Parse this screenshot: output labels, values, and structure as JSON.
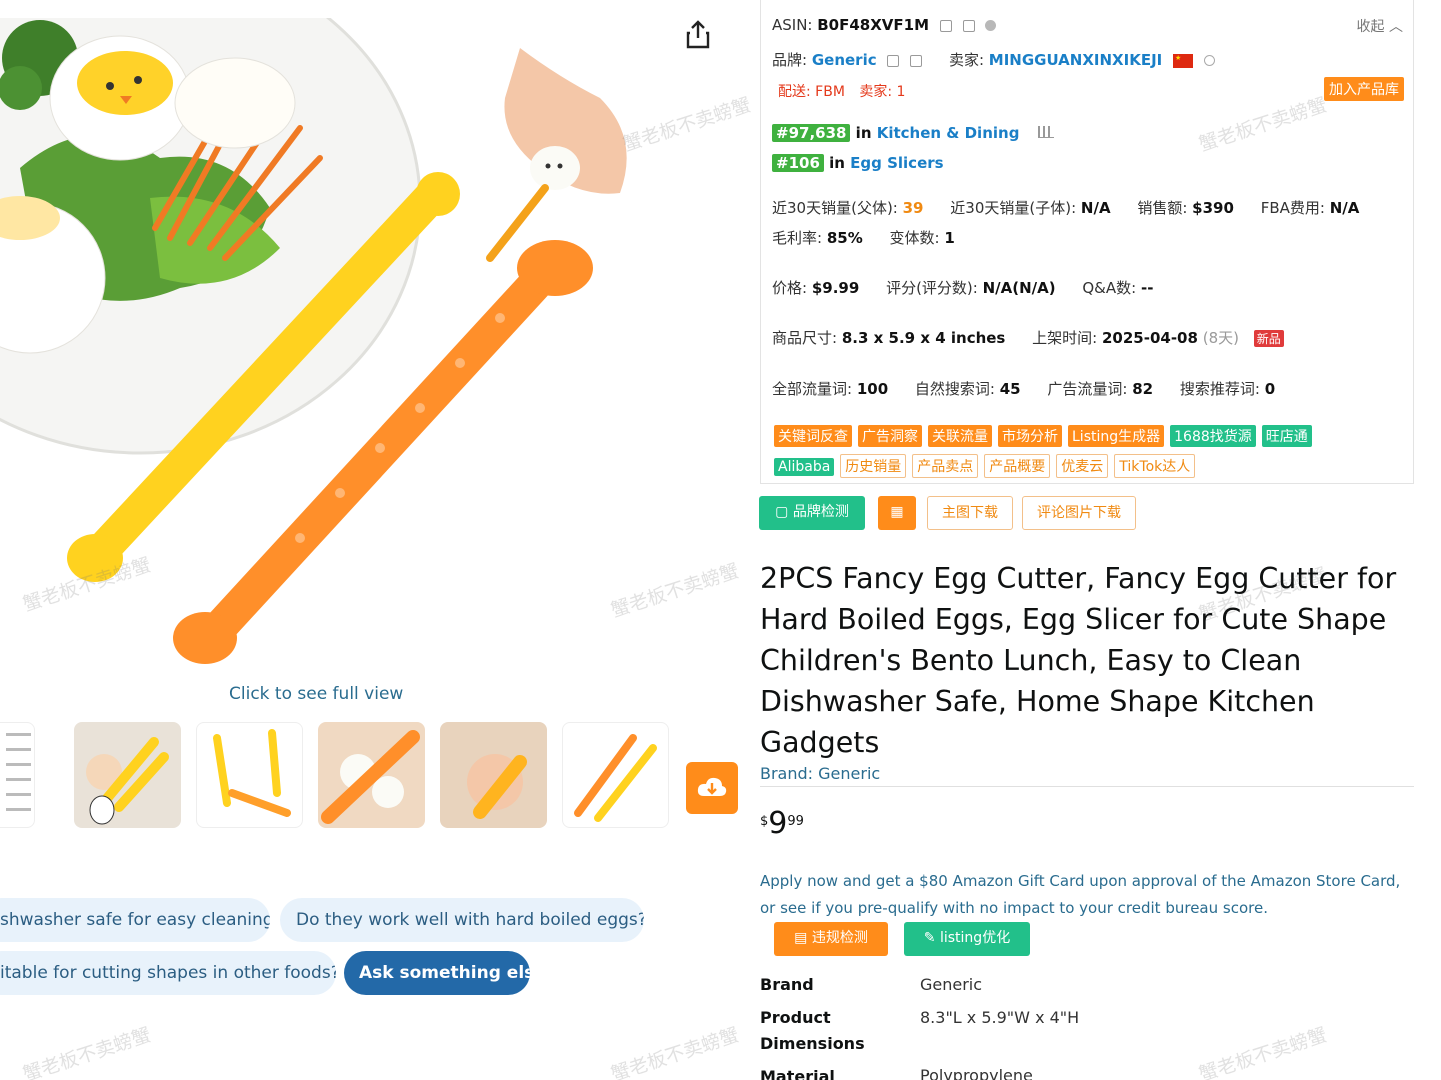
{
  "gallery": {
    "click_full_view": "Click to see full view",
    "thumbnail_count": 6
  },
  "chips": [
    {
      "label": "shwasher safe for easy cleaning?"
    },
    {
      "label": "Do they work well with hard boiled eggs?"
    },
    {
      "label": "itable for cutting shapes in other foods?"
    },
    {
      "label": "Ask something else"
    }
  ],
  "watermark": "蟹老板不卖螃蟹",
  "panel": {
    "collapse": "收起 ︿",
    "asin_label": "ASIN: ",
    "asin": "B0F48XVF1M",
    "brand_label": "品牌: ",
    "brand": "Generic",
    "seller_label": "卖家: ",
    "seller": "MINGGUANXINXIKEJI",
    "shipping": "配送: FBM",
    "sellers_count": "卖家: 1",
    "add_to_library": "加入产品库",
    "rank1_num": "#97,638",
    "rank1_in": " in ",
    "rank1_cat": "Kitchen & Dining",
    "rank2_num": "#106",
    "rank2_in": " in ",
    "rank2_cat": "Egg Slicers",
    "sales_parent_label": "近30天销量(父体): ",
    "sales_parent": "39",
    "sales_child_label": "近30天销量(子体): ",
    "sales_child": "N/A",
    "revenue_label": "销售额: ",
    "revenue": "$390",
    "fba_label": "FBA费用: ",
    "fba": "N/A",
    "margin_label": "毛利率: ",
    "margin": "85%",
    "variants_label": "变体数: ",
    "variants": "1",
    "price_label": "价格: ",
    "price": "$9.99",
    "rating_label": "评分(评分数): ",
    "rating": "N/A(N/A)",
    "qa_label": "Q&A数: ",
    "qa": "--",
    "size_label": "商品尺寸: ",
    "size": "8.3 x 5.9 x 4 inches",
    "listed_label": "上架时间: ",
    "listed": "2025-04-08",
    "listed_days": "(8天)",
    "new_badge": "新品",
    "traffic_all_label": "全部流量词: ",
    "traffic_all": "100",
    "traffic_organic_label": "自然搜索词: ",
    "traffic_organic": "45",
    "traffic_ad_label": "广告流量词: ",
    "traffic_ad": "82",
    "traffic_rec_label": "搜索推荐词: ",
    "traffic_rec": "0",
    "tools_row1": [
      {
        "label": "关键词反查",
        "style": "o"
      },
      {
        "label": "广告洞察",
        "style": "o"
      },
      {
        "label": "关联流量",
        "style": "o"
      },
      {
        "label": "市场分析",
        "style": "o"
      },
      {
        "label": "Listing生成器",
        "style": "o"
      },
      {
        "label": "1688找货源",
        "style": "g"
      },
      {
        "label": "旺店通",
        "style": "g"
      }
    ],
    "tools_row2": [
      {
        "label": "Alibaba",
        "style": "g"
      },
      {
        "label": "历史销量",
        "style": "line"
      },
      {
        "label": "产品卖点",
        "style": "line"
      },
      {
        "label": "产品概要",
        "style": "line"
      },
      {
        "label": "优麦云",
        "style": "line"
      },
      {
        "label": "TikTok达人",
        "style": "line"
      }
    ]
  },
  "actions": {
    "brand_check": "品牌检测",
    "main_image_download": "主图下载",
    "review_image_download": "评论图片下载"
  },
  "product": {
    "title": "2PCS Fancy Egg Cutter, Fancy Egg Cutter for Hard Boiled Eggs, Egg Slicer for Cute Shape Children's Bento Lunch, Easy to Clean Dishwasher Safe, Home Shape Kitchen Gadgets",
    "brand_link": "Brand: Generic",
    "price_symbol": "$",
    "price_whole": "9",
    "price_fraction": "99",
    "promo": "Apply now and get a $80 Amazon Gift Card upon approval of the Amazon Store Card, or see if you pre-qualify with no impact to your credit bureau score.",
    "violation_check": "违规检测",
    "listing_optimize": "listing优化",
    "specs": [
      {
        "label": "Brand",
        "value": "Generic"
      },
      {
        "label": "Product Dimensions",
        "value": "8.3\"L x 5.9\"W x 4\"H"
      },
      {
        "label": "Material",
        "value": "Polypropylene"
      }
    ]
  },
  "colors": {
    "orange": "#ff8c1a",
    "green": "#22c08a",
    "rank_green": "#3fb13f",
    "link_blue": "#1a7fc7",
    "chip_bg": "#e8f2fb",
    "chip_dark": "#2369a8"
  }
}
